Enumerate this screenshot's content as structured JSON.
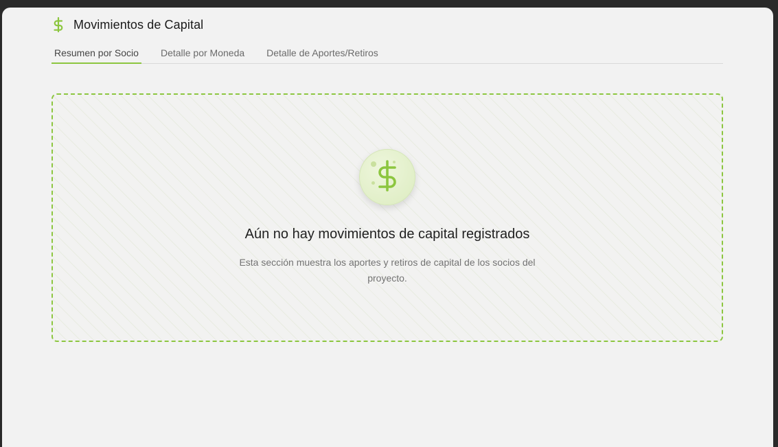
{
  "header": {
    "icon": "dollar-icon",
    "title": "Movimientos de Capital"
  },
  "tabs": [
    {
      "label": "Resumen por Socio",
      "active": true
    },
    {
      "label": "Detalle por Moneda",
      "active": false
    },
    {
      "label": "Detalle de Aportes/Retiros",
      "active": false
    }
  ],
  "empty_state": {
    "icon": "dollar-icon",
    "title": "Aún no hay movimientos de capital registrados",
    "description": "Esta sección muestra los aportes y retiros de capital de los socios del proyecto."
  },
  "colors": {
    "accent": "#8cc63f",
    "background": "#f2f2f2",
    "frame": "#2a2a2a"
  }
}
